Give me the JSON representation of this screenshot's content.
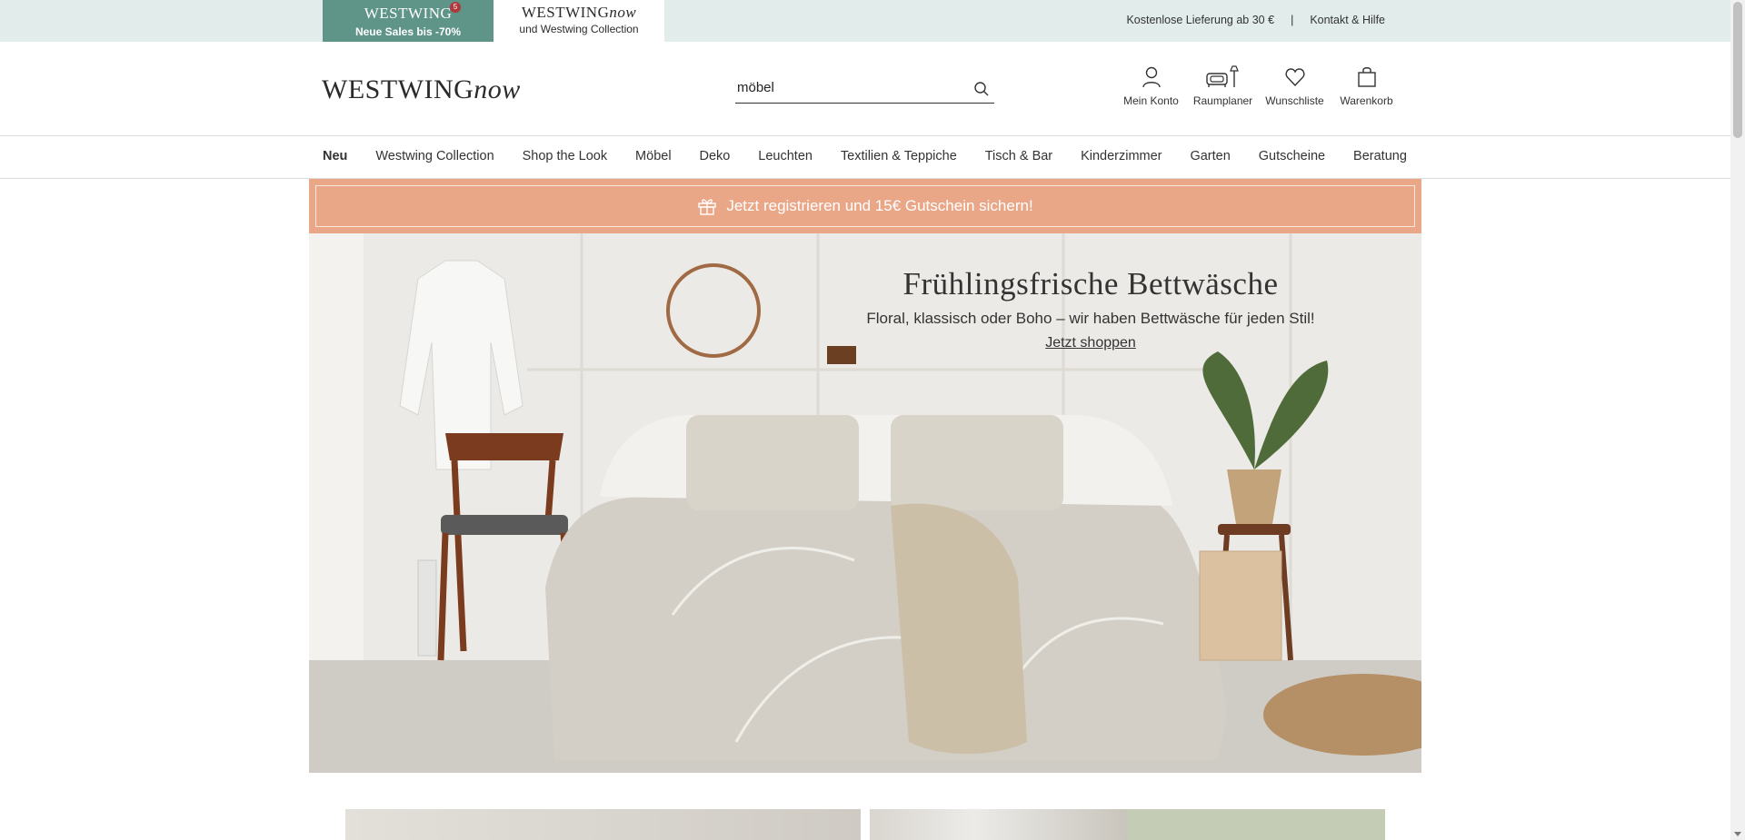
{
  "topbar": {
    "sales_tab": {
      "brand": "WESTWING",
      "badge": "5",
      "subtitle": "Neue Sales bis -70%"
    },
    "now_tab": {
      "brand_main": "WESTWING",
      "brand_italic": "now",
      "subtitle": "und Westwing Collection"
    },
    "links": [
      {
        "label": "Kostenlose Lieferung ab 30 €"
      },
      {
        "label": "Kontakt & Hilfe"
      }
    ],
    "separator": "|"
  },
  "header": {
    "logo_main": "WESTWING",
    "logo_italic": "now",
    "search": {
      "value": "möbel",
      "icon": "search-icon"
    },
    "icons": [
      {
        "label": "Mein Konto",
        "icon": "user-icon"
      },
      {
        "label": "Raumplaner",
        "icon": "room-planner-icon"
      },
      {
        "label": "Wunschliste",
        "icon": "heart-icon"
      },
      {
        "label": "Warenkorb",
        "icon": "shopping-bag-icon"
      }
    ]
  },
  "categories": [
    "Neu",
    "Westwing Collection",
    "Shop the Look",
    "Möbel",
    "Deko",
    "Leuchten",
    "Textilien & Teppiche",
    "Tisch & Bar",
    "Kinderzimmer",
    "Garten",
    "Gutscheine",
    "Beratung"
  ],
  "promo": {
    "text": "Jetzt registrieren und 15€ Gutschein sichern!",
    "icon": "gift-icon",
    "color": "#eaa788"
  },
  "hero": {
    "title": "Frühlingsfrische Bettwäsche",
    "subtitle": "Floral, klassisch oder Boho – wir haben Bettwäsche für jeden Stil!",
    "cta": "Jetzt shoppen"
  },
  "colors": {
    "topbar_bg": "#e2eceb",
    "sales_tab": "#5e9588",
    "badge": "#b0383b"
  }
}
